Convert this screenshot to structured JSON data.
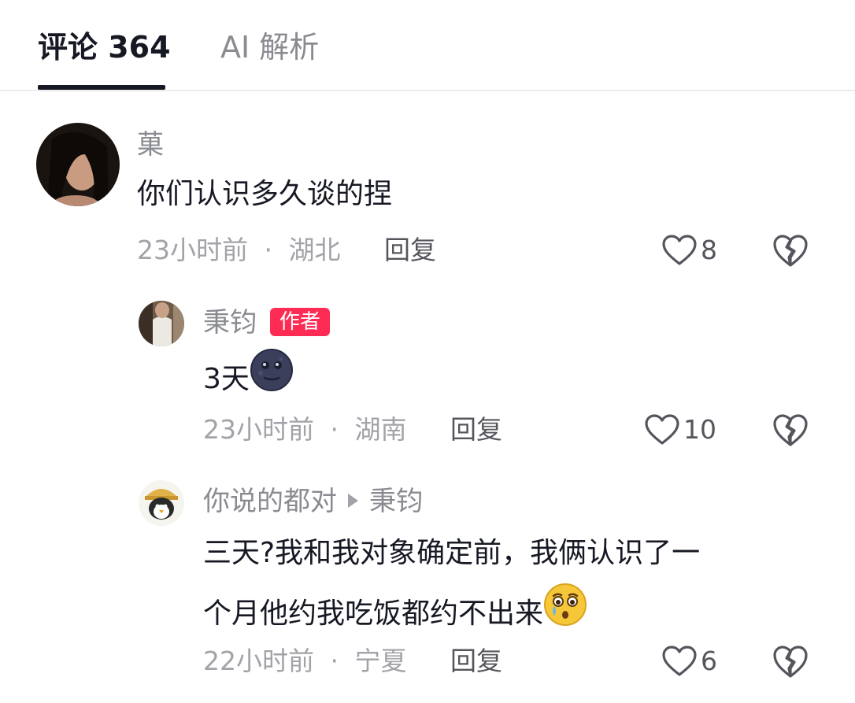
{
  "tabs": {
    "comments_label": "评论 364",
    "ai_label": "AI 解析"
  },
  "comments": [
    {
      "username": "菓",
      "text": "你们认识多久谈的捏",
      "time": "23小时前",
      "location": "湖北",
      "reply_label": "回复",
      "likes": "8"
    }
  ],
  "replies": [
    {
      "username": "秉钧",
      "badge": "作者",
      "text": "3天",
      "emoji_icon": "new-moon-face-emoji",
      "time": "23小时前",
      "location": "湖南",
      "reply_label": "回复",
      "likes": "10"
    },
    {
      "username": "你说的都对",
      "reply_to": "秉钧",
      "text_line1": "三天?我和我对象确定前，我俩认识了一",
      "text_line2": "个月他约我吃饭都约不出来",
      "emoji_icon": "crying-face-emoji",
      "time": "22小时前",
      "location": "宁夏",
      "reply_label": "回复",
      "likes": "6"
    }
  ],
  "separator": "·",
  "colors": {
    "accent": "#fe2c55",
    "primary_text": "#161823",
    "secondary_text": "#8a8b91"
  }
}
